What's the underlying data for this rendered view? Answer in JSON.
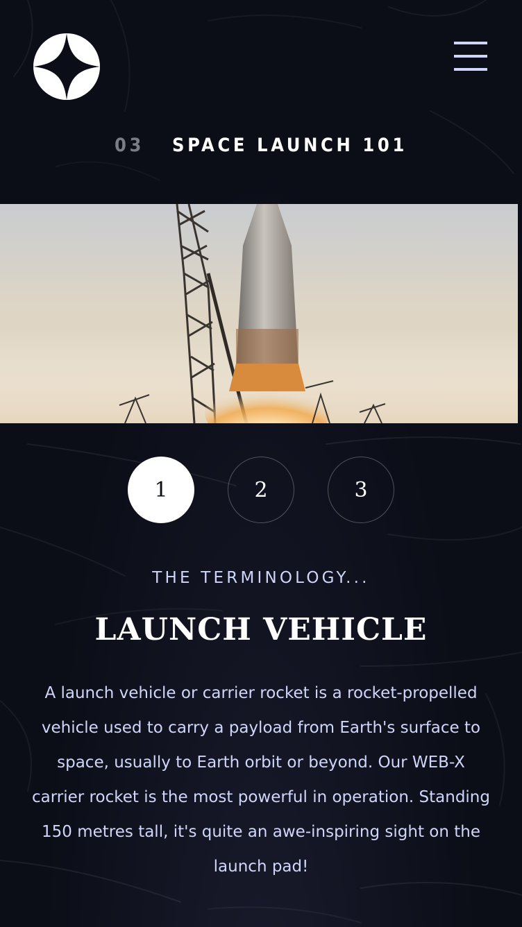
{
  "header": {
    "logo_icon": "star-logo-icon",
    "menu_icon": "hamburger-menu-icon"
  },
  "page_heading": {
    "number": "03",
    "title": "SPACE LAUNCH 101"
  },
  "hero": {
    "image": "rocket-launch-image"
  },
  "tabs": [
    {
      "label": "1",
      "active": true
    },
    {
      "label": "2",
      "active": false
    },
    {
      "label": "3",
      "active": false
    }
  ],
  "content": {
    "eyebrow": "THE TERMINOLOGY...",
    "title": "LAUNCH VEHICLE",
    "description": "A launch vehicle or carrier rocket is a rocket-propelled vehicle used to carry a payload from Earth's surface to space, usually to Earth orbit or beyond. Our WEB-X carrier rocket is the most powerful in operation. Standing 150 metres tall, it's quite an awe-inspiring sight on the launch pad!"
  },
  "colors": {
    "background": "#0b0d17",
    "accent": "#d0d6f9",
    "white": "#ffffff"
  }
}
